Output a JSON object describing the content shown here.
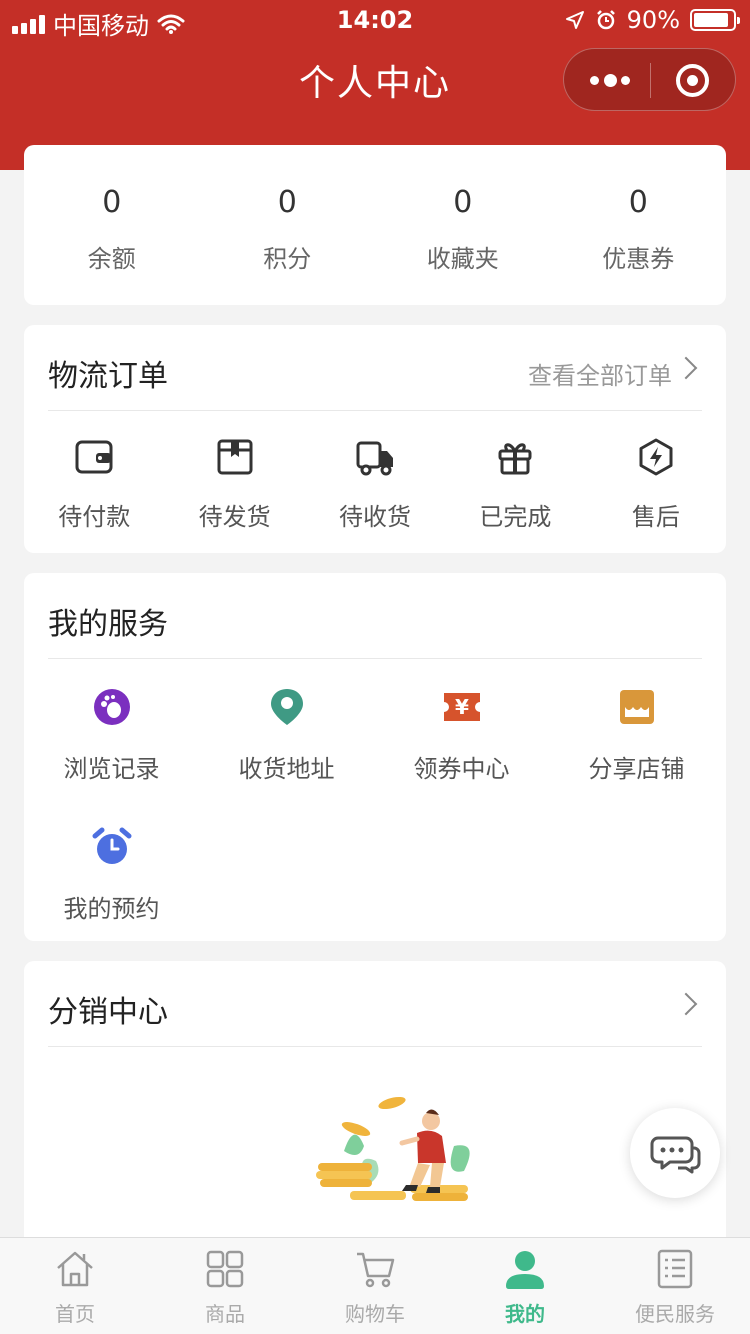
{
  "status_bar": {
    "carrier": "中国移动",
    "time": "14:02",
    "battery": "90%",
    "battery_level": 0.9
  },
  "header": {
    "title": "个人中心"
  },
  "stats": [
    {
      "value": "0",
      "label": "余额"
    },
    {
      "value": "0",
      "label": "积分"
    },
    {
      "value": "0",
      "label": "收藏夹"
    },
    {
      "value": "0",
      "label": "优惠券"
    }
  ],
  "orders": {
    "title": "物流订单",
    "view_all": "查看全部订单",
    "items": [
      {
        "label": "待付款",
        "icon": "wallet-icon"
      },
      {
        "label": "待发货",
        "icon": "package-icon"
      },
      {
        "label": "待收货",
        "icon": "truck-icon"
      },
      {
        "label": "已完成",
        "icon": "gift-icon"
      },
      {
        "label": "售后",
        "icon": "lightning-icon"
      }
    ]
  },
  "services": {
    "title": "我的服务",
    "items": [
      {
        "label": "浏览记录",
        "icon": "footprint-icon",
        "color": "#7b2fbf"
      },
      {
        "label": "收货地址",
        "icon": "location-pin-icon",
        "color": "#3f9a84"
      },
      {
        "label": "领券中心",
        "icon": "coupon-icon",
        "color": "#d6532c"
      },
      {
        "label": "分享店铺",
        "icon": "store-icon",
        "color": "#d9973a"
      },
      {
        "label": "我的预约",
        "icon": "alarm-clock-icon",
        "color": "#4d6fe0"
      }
    ]
  },
  "distribution": {
    "title": "分销中心"
  },
  "tabbar": {
    "items": [
      {
        "label": "首页",
        "icon": "home-icon",
        "active": false
      },
      {
        "label": "商品",
        "icon": "grid-icon",
        "active": false
      },
      {
        "label": "购物车",
        "icon": "cart-icon",
        "active": false
      },
      {
        "label": "我的",
        "icon": "user-icon",
        "active": true
      },
      {
        "label": "便民服务",
        "icon": "document-list-icon",
        "active": false
      }
    ]
  },
  "colors": {
    "header": "#c42f27",
    "active_tab": "#3fb98b"
  }
}
